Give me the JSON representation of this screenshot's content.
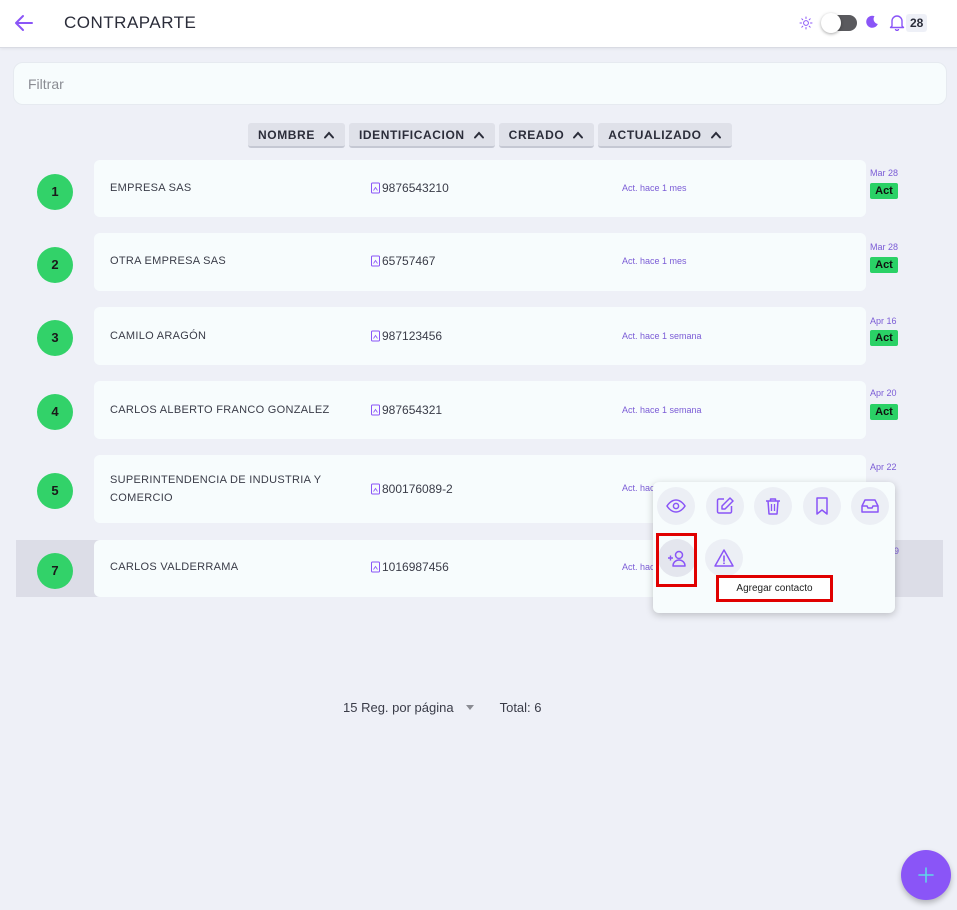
{
  "header": {
    "title": "CONTRAPARTE",
    "notification_count": "28",
    "accent_color": "#8a55f7"
  },
  "filter": {
    "placeholder": "Filtrar"
  },
  "sort_columns": [
    {
      "label": "NOMBRE"
    },
    {
      "label": "IDENTIFICACION"
    },
    {
      "label": "CREADO"
    },
    {
      "label": "ACTUALIZADO"
    }
  ],
  "rows": [
    {
      "num": "1",
      "name": "EMPRESA SAS",
      "id": "9876543210",
      "updated": "Act. hace 1 mes",
      "date": "Mar 28",
      "status": "Act"
    },
    {
      "num": "2",
      "name": "OTRA EMPRESA SAS",
      "id": "65757467",
      "updated": "Act. hace 1 mes",
      "date": "Mar 28",
      "status": "Act"
    },
    {
      "num": "3",
      "name": "CAMILO ARAGÓN",
      "id": "987123456",
      "updated": "Act. hace 1 semana",
      "date": "Apr 16",
      "status": "Act"
    },
    {
      "num": "4",
      "name": "CARLOS ALBERTO FRANCO GONZALEZ",
      "id": "987654321",
      "updated": "Act. hace 1 semana",
      "date": "Apr 20",
      "status": "Act"
    },
    {
      "num": "5",
      "name_line1": "SUPERINTENDENCIA DE INDUSTRIA Y",
      "name_line2": "COMERCIO",
      "id": "800176089-2",
      "updated": "Act. hace",
      "date": "Apr 22"
    },
    {
      "num": "7",
      "name": "CARLOS VALDERRAMA",
      "id": "1016987456",
      "updated": "Act. hac",
      "date": "9"
    }
  ],
  "actions_popup": {
    "icons": [
      "eye-icon",
      "edit-icon",
      "trash-icon",
      "bookmark-icon",
      "archive-icon",
      "add-user-icon",
      "warning-icon"
    ],
    "tooltip": "Agregar contacto"
  },
  "pagination": {
    "per_page_label": "15 Reg. por página",
    "total_label": "Total: 6"
  }
}
